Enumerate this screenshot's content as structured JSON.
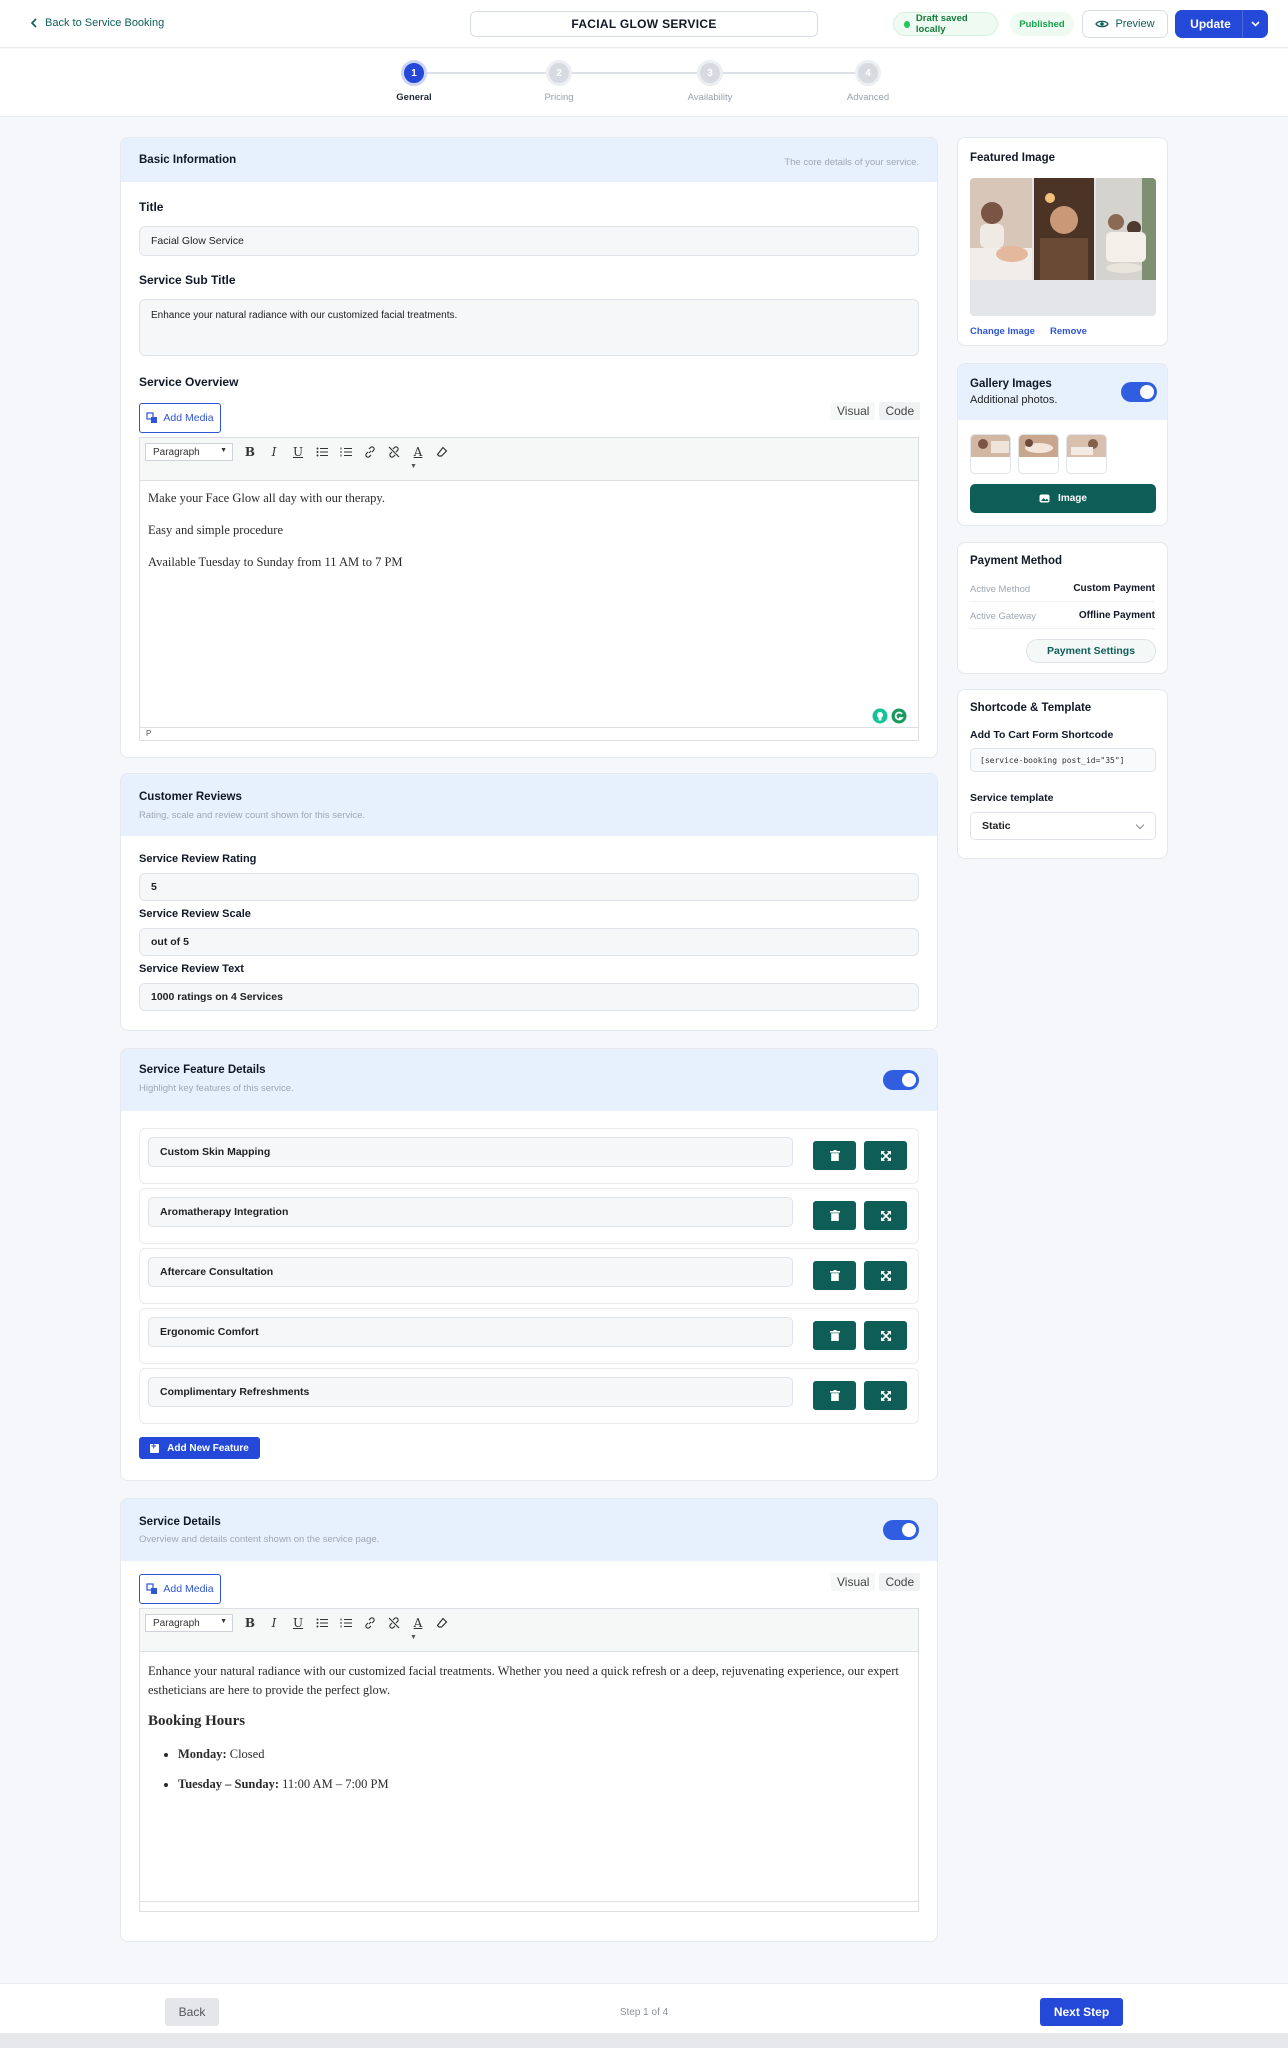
{
  "header": {
    "back_label": "Back to Service Booking",
    "title": "FACIAL GLOW SERVICE",
    "draft_status": "Draft saved locally",
    "published_status": "Published",
    "preview_label": "Preview",
    "update_label": "Update"
  },
  "stepper": {
    "steps": [
      {
        "number": "1",
        "label": "General"
      },
      {
        "number": "2",
        "label": "Pricing"
      },
      {
        "number": "3",
        "label": "Availability"
      },
      {
        "number": "4",
        "label": "Advanced"
      }
    ],
    "current": 1
  },
  "basic_info": {
    "heading": "Basic Information",
    "hint": "The core details of your service.",
    "title_label": "Title",
    "title_value": "Facial Glow Service",
    "subtitle_label": "Service Sub Title",
    "subtitle_value": "Enhance your natural radiance with our customized facial treatments.",
    "overview_label": "Service Overview",
    "add_media": "Add Media",
    "visual_tab": "Visual",
    "code_tab": "Code",
    "format_select": "Paragraph",
    "paragraphs": [
      "Make your Face Glow all day with our therapy.",
      "Easy and simple procedure",
      "Available Tuesday to Sunday from 11 AM to 7 PM"
    ],
    "path_label": "P"
  },
  "reviews": {
    "heading": "Customer Reviews",
    "hint": "Rating, scale and review count shown for this service.",
    "rating_label": "Service Review Rating",
    "rating_value": "5",
    "scale_label": "Service Review Scale",
    "scale_value": "out of 5",
    "text_label": "Service Review Text",
    "text_value": "1000 ratings on 4 Services"
  },
  "features": {
    "heading": "Service Feature Details",
    "hint": "Highlight key features of this service.",
    "enabled": true,
    "items": [
      "Custom Skin Mapping",
      "Aromatherapy Integration",
      "Aftercare Consultation",
      "Ergonomic Comfort",
      "Complimentary Refreshments"
    ],
    "add_label": "Add New Feature"
  },
  "details": {
    "heading": "Service Details",
    "hint": "Overview and details content shown on the service page.",
    "enabled": true,
    "add_media": "Add Media",
    "visual_tab": "Visual",
    "code_tab": "Code",
    "format_select": "Paragraph",
    "intro": "Enhance your natural radiance with our customized facial treatments. Whether you need a quick refresh or a deep, rejuvenating experience, our expert estheticians are here to provide the perfect glow.",
    "hours_heading": "Booking Hours",
    "hours": [
      {
        "day": "Monday:",
        "time": " Closed"
      },
      {
        "day": "Tuesday – Sunday:",
        "time": " 11:00 AM – 7:00 PM"
      }
    ]
  },
  "sidebar": {
    "featured": {
      "title": "Featured Image",
      "change": "Change Image",
      "remove": "Remove"
    },
    "gallery": {
      "title": "Gallery Images",
      "subtitle": "Additional photos.",
      "enabled": true,
      "button": "Image"
    },
    "payment": {
      "title": "Payment Method",
      "method_label": "Active Method",
      "method_value": "Custom Payment",
      "gateway_label": "Active Gateway",
      "gateway_value": "Offline Payment",
      "settings_button": "Payment Settings"
    },
    "shortcode": {
      "title": "Shortcode & Template",
      "cart_label": "Add To Cart Form Shortcode",
      "cart_value": "[service-booking post_id=\"35\"]",
      "template_label": "Service template",
      "template_value": "Static"
    }
  },
  "footer": {
    "back": "Back",
    "step_text": "Step 1 of 4",
    "next": "Next Step"
  },
  "colors": {
    "primary": "#2448d8",
    "teal": "#0e5e57",
    "card_head": "#e7f0fd"
  }
}
